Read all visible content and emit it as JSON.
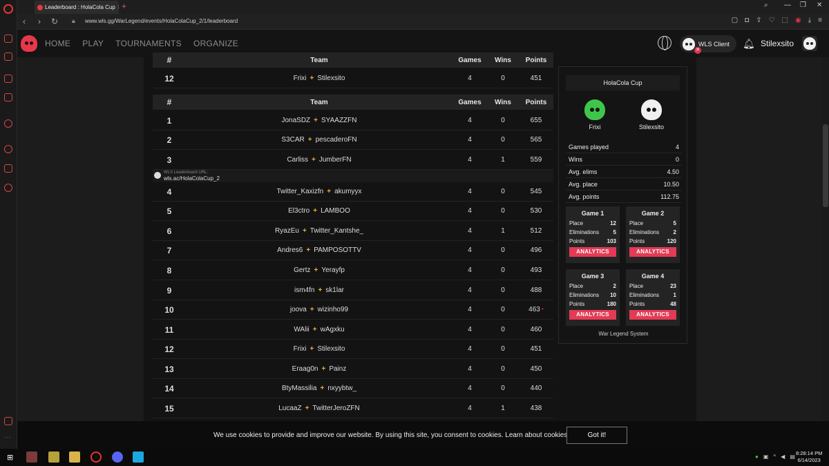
{
  "browser": {
    "tab_title": "Leaderboard : HolaCola Cup",
    "url": "www.wls.gg/WarLegend/events/HolaColaCup_2/1/leaderboard"
  },
  "site": {
    "nav": [
      "HOME",
      "PLAY",
      "TOURNAMENTS",
      "ORGANIZE"
    ],
    "client_label": "WLS Client",
    "username": "Stilexsito"
  },
  "table_headers": {
    "rank": "#",
    "team": "Team",
    "games": "Games",
    "wins": "Wins",
    "points": "Points"
  },
  "own_team": {
    "rank": "12",
    "p1": "Frixi",
    "p2": "Stilexsito",
    "games": "4",
    "wins": "0",
    "points": "451"
  },
  "leaderboard": [
    {
      "rank": "1",
      "p1": "JonaSDZ",
      "p2": "SYAAZZFN",
      "games": "4",
      "wins": "0",
      "points": "655"
    },
    {
      "rank": "2",
      "p1": "S3CAR",
      "p2": "pescaderoFN",
      "games": "4",
      "wins": "0",
      "points": "565"
    },
    {
      "rank": "3",
      "p1": "Carliss",
      "p2": "JumberFN",
      "games": "4",
      "wins": "1",
      "points": "559"
    },
    {
      "rank": "4",
      "p1": "Twitter_Kaxizfn",
      "p2": "akumyyx",
      "games": "4",
      "wins": "0",
      "points": "545"
    },
    {
      "rank": "5",
      "p1": "El3ctro",
      "p2": "LAMBOO",
      "games": "4",
      "wins": "0",
      "points": "530"
    },
    {
      "rank": "6",
      "p1": "RyazEu",
      "p2": "Twitter_Kantshe_",
      "games": "4",
      "wins": "1",
      "points": "512"
    },
    {
      "rank": "7",
      "p1": "Andres6",
      "p2": "PAMPOSOTTV",
      "games": "4",
      "wins": "0",
      "points": "496"
    },
    {
      "rank": "8",
      "p1": "Gertz",
      "p2": "Yerayfp",
      "games": "4",
      "wins": "0",
      "points": "493"
    },
    {
      "rank": "9",
      "p1": "ism4fn",
      "p2": "sk1lar",
      "games": "4",
      "wins": "0",
      "points": "488"
    },
    {
      "rank": "10",
      "p1": "joova",
      "p2": "wizinho99",
      "games": "4",
      "wins": "0",
      "points": "463"
    },
    {
      "rank": "11",
      "p1": "WAlii",
      "p2": "wAgxku",
      "games": "4",
      "wins": "0",
      "points": "460"
    },
    {
      "rank": "12",
      "p1": "Frixi",
      "p2": "Stilexsito",
      "games": "4",
      "wins": "0",
      "points": "451"
    },
    {
      "rank": "13",
      "p1": "Eraag0n",
      "p2": "Painz",
      "games": "4",
      "wins": "0",
      "points": "450"
    },
    {
      "rank": "14",
      "p1": "BtyMassilia",
      "p2": "nxyybtw_",
      "games": "4",
      "wins": "0",
      "points": "440"
    },
    {
      "rank": "15",
      "p1": "LucaaZ",
      "p2": "TwitterJeroZFN",
      "games": "4",
      "wins": "1",
      "points": "438"
    }
  ],
  "leaderboard_url": {
    "label": "WLS Leaderboard URL:",
    "value": "wls.ac/HolaColaCup_2"
  },
  "panel": {
    "title": "HolaCola Cup",
    "players": [
      "Frixi",
      "Stilexsito"
    ],
    "stats": [
      {
        "label": "Games played",
        "value": "4"
      },
      {
        "label": "Wins",
        "value": "0"
      },
      {
        "label": "Avg. elims",
        "value": "4.50"
      },
      {
        "label": "Avg. place",
        "value": "10.50"
      },
      {
        "label": "Avg. points",
        "value": "112.75"
      }
    ],
    "games": [
      {
        "title": "Game 1",
        "place": "12",
        "elims": "5",
        "points": "103"
      },
      {
        "title": "Game 2",
        "place": "5",
        "elims": "2",
        "points": "120"
      },
      {
        "title": "Game 3",
        "place": "2",
        "elims": "10",
        "points": "180"
      },
      {
        "title": "Game 4",
        "place": "23",
        "elims": "1",
        "points": "48"
      }
    ],
    "labels": {
      "place": "Place",
      "elims": "Eliminations",
      "points": "Points",
      "analytics": "ANALYTICS"
    },
    "footer": "War Legend System"
  },
  "cookie": {
    "text": "We use cookies to provide and improve our website. By using this site, you consent to cookies. Learn about cookies",
    "button": "Got it!"
  },
  "taskbar": {
    "time": "8:28:14 PM",
    "date": "6/14/2023"
  },
  "colors": {
    "accent": "#e33a55",
    "plus": "#e5b63c",
    "green_avatar": "#3fc64a"
  }
}
